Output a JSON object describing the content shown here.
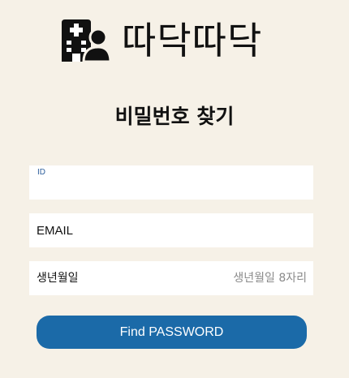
{
  "logo": {
    "icon": "hospital-user-icon",
    "text": "따닥따닥"
  },
  "page": {
    "title": "비밀번호 찾기"
  },
  "form": {
    "id_label": "ID",
    "id_value": "",
    "email_placeholder": "EMAIL",
    "birth_label": "생년월일",
    "birth_placeholder": "생년월일 8자리",
    "submit_label": "Find PASSWORD"
  },
  "colors": {
    "background": "#f6f1e7",
    "button": "#1b6aa8",
    "id_label": "#2b5d9b"
  }
}
